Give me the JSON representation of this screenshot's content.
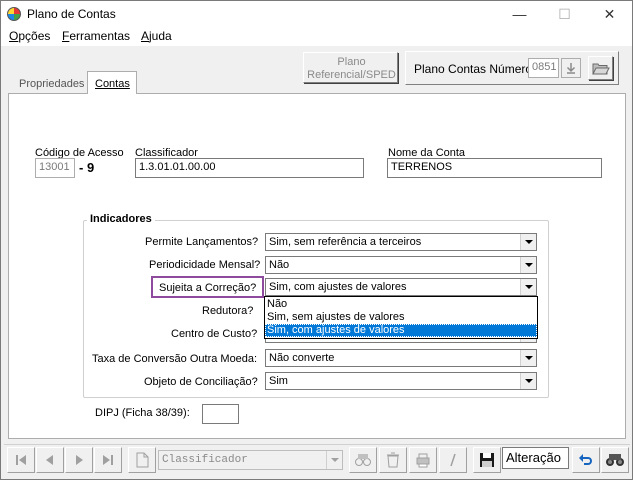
{
  "window": {
    "title": "Plano de Contas",
    "minimize": "—",
    "maximize": "☐",
    "close": "✕"
  },
  "menu": [
    {
      "prefix": "",
      "underlined": "O",
      "rest": "pções"
    },
    {
      "prefix": "",
      "underlined": "F",
      "rest": "erramentas"
    },
    {
      "prefix": "",
      "underlined": "A",
      "rest": "juda"
    }
  ],
  "toolbar": {
    "plano_referencial_line1": "Plano",
    "plano_referencial_line2": "Referencial/SPED",
    "plano_numero_label": "Plano Contas Número",
    "plano_numero_value": "0851"
  },
  "tabs": [
    {
      "label": "Propriedades"
    },
    {
      "label": "Contas"
    }
  ],
  "form": {
    "codigo_label": "Código de Acesso",
    "codigo_value": "13001",
    "codigo_digit": "- 9",
    "classificador_label": "Classificador",
    "classificador_value": "1.3.01.01.00.00",
    "nome_label": "Nome da Conta",
    "nome_value": "TERRENOS"
  },
  "indicadores": {
    "title": "Indicadores",
    "fields": [
      {
        "label": "Permite Lançamentos?",
        "value": "Sim, sem referência a terceiros"
      },
      {
        "label": "Periodicidade Mensal?",
        "value": "Não"
      },
      {
        "label": "Sujeita a Correção?",
        "value": "Sim, com ajustes de valores"
      },
      {
        "label": "Redutora?",
        "value": ""
      },
      {
        "label": "Centro de Custo?",
        "value": ""
      },
      {
        "label": "Taxa de Conversão Outra Moeda:",
        "value": "Não converte"
      },
      {
        "label": "Objeto de Conciliação?",
        "value": "Sim"
      }
    ],
    "dropdown_options": [
      "Não",
      "Sim, sem ajustes de valores",
      "Sim, com ajustes de valores"
    ],
    "dropdown_selected_index": 2
  },
  "dipj": {
    "label": "DIPJ (Ficha 38/39):",
    "value": ""
  },
  "navbar": {
    "search_combo": "Classificador",
    "mode": "Alteração"
  },
  "colors": {
    "highlight": "#8e4a9d",
    "selection": "#0078d7"
  }
}
